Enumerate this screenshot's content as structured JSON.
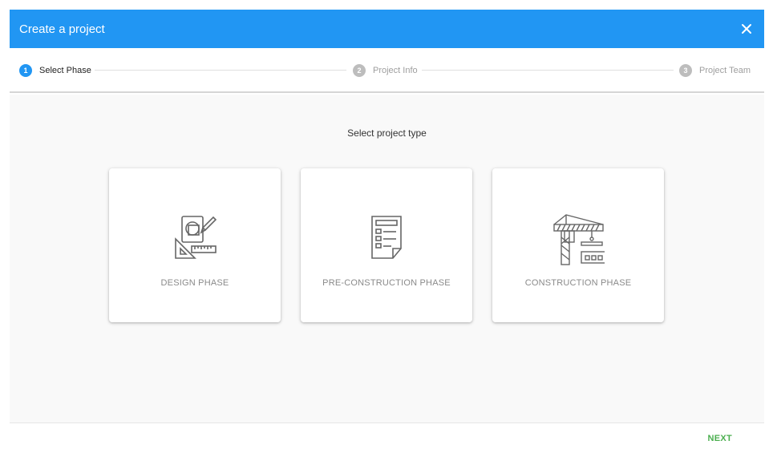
{
  "dialog": {
    "title": "Create a project",
    "accent_color": "#2196f3"
  },
  "stepper": {
    "steps": [
      {
        "number": "1",
        "label": "Select Phase",
        "active": true
      },
      {
        "number": "2",
        "label": "Project Info",
        "active": false
      },
      {
        "number": "3",
        "label": "Project Team",
        "active": false
      }
    ]
  },
  "main": {
    "subtitle": "Select project type",
    "cards": [
      {
        "label": "DESIGN PHASE",
        "icon": "design-tools-icon"
      },
      {
        "label": "PRE-CONSTRUCTION PHASE",
        "icon": "document-checklist-icon"
      },
      {
        "label": "CONSTRUCTION PHASE",
        "icon": "crane-icon"
      }
    ]
  },
  "footer": {
    "next_label": "NEXT",
    "next_color": "#4caf50"
  }
}
